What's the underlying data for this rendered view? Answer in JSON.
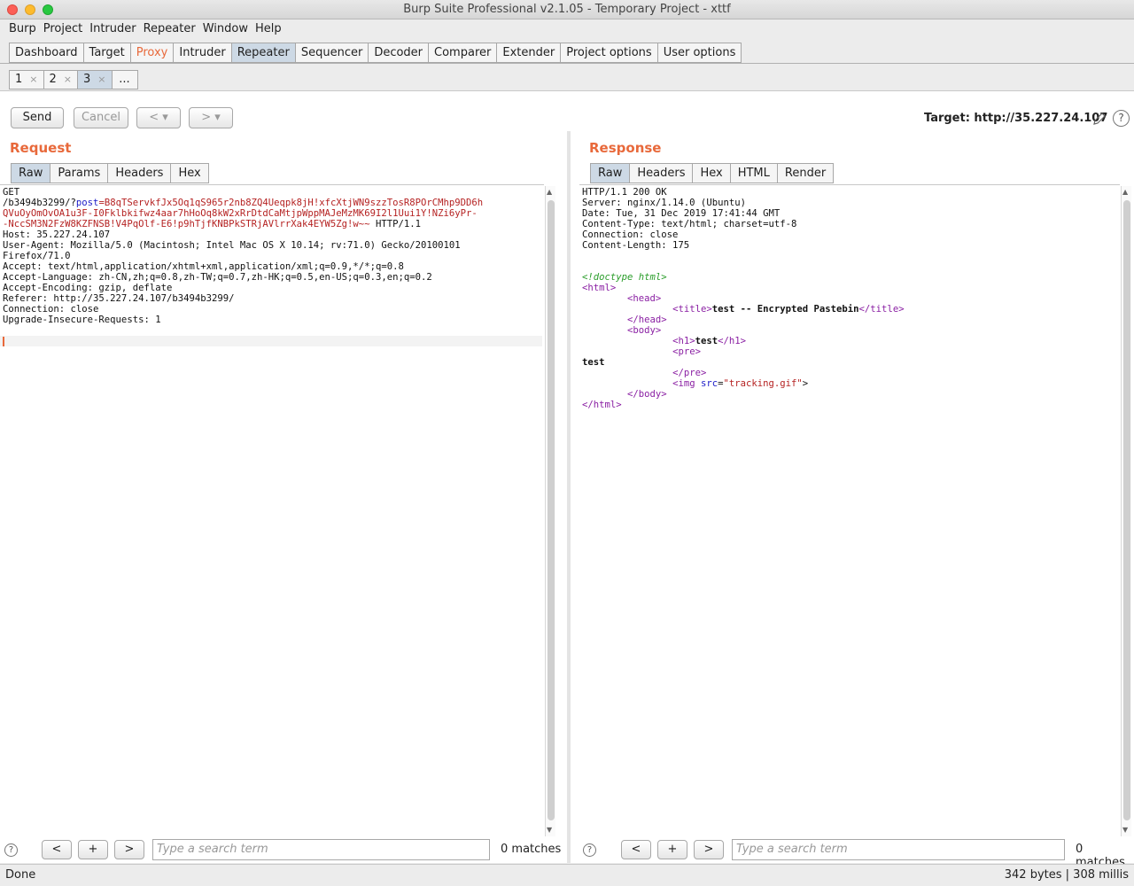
{
  "window": {
    "title": "Burp Suite Professional v2.1.05 - Temporary Project - xttf"
  },
  "menu": [
    "Burp",
    "Project",
    "Intruder",
    "Repeater",
    "Window",
    "Help"
  ],
  "main_tabs": [
    "Dashboard",
    "Target",
    "Proxy",
    "Intruder",
    "Repeater",
    "Sequencer",
    "Decoder",
    "Comparer",
    "Extender",
    "Project options",
    "User options"
  ],
  "sub_tabs": [
    "1",
    "2",
    "3",
    "..."
  ],
  "toolbar": {
    "send": "Send",
    "cancel": "Cancel",
    "back": "< ▾",
    "forward": "> ▾",
    "target_label": "Target: http://35.227.24.107"
  },
  "request": {
    "title": "Request",
    "tabs": [
      "Raw",
      "Params",
      "Headers",
      "Hex"
    ],
    "line1": "GET",
    "line2_prefix": "/b3494b3299/?",
    "param_name": "post",
    "param_eq": "=",
    "param_val_1": "B8qTServkfJx5Oq1qS965r2nb8ZQ4Ueqpk8jH!xfcXtjWN9szzTosR8POrCMhp9DD6h",
    "param_val_2": "QVuOyOmOvOA1u3F-I0Fklbkifwz4aar7hHoOq8kW2xRrDtdCaMtjpWppMAJeMzMK69I2l1Uui1Y!NZi6yPr-",
    "param_val_3": "-NccSM3N2FzW8KZFNSB!V4PqOlf-E6!p9hTjfKNBPkSTRjAVlrrXak4EYW5Zg!w~~",
    "http_ver": " HTTP/1.1",
    "headers": "Host: 35.227.24.107\nUser-Agent: Mozilla/5.0 (Macintosh; Intel Mac OS X 10.14; rv:71.0) Gecko/20100101\nFirefox/71.0\nAccept: text/html,application/xhtml+xml,application/xml;q=0.9,*/*;q=0.8\nAccept-Language: zh-CN,zh;q=0.8,zh-TW;q=0.7,zh-HK;q=0.5,en-US;q=0.3,en;q=0.2\nAccept-Encoding: gzip, deflate\nReferer: http://35.227.24.107/b3494b3299/\nConnection: close\nUpgrade-Insecure-Requests: 1"
  },
  "response": {
    "title": "Response",
    "tabs": [
      "Raw",
      "Headers",
      "Hex",
      "HTML",
      "Render"
    ],
    "headers": "HTTP/1.1 200 OK\nServer: nginx/1.14.0 (Ubuntu)\nDate: Tue, 31 Dec 2019 17:41:44 GMT\nContent-Type: text/html; charset=utf-8\nConnection: close\nContent-Length: 175",
    "doctype": "<!doctype html>",
    "html_open": "<html>",
    "head_open": "<head>",
    "title_open": "<title>",
    "title_text": "test -- Encrypted Pastebin",
    "title_close": "</title>",
    "head_close": "</head>",
    "body_open": "<body>",
    "h1_open": "<h1>",
    "h1_text": "test",
    "h1_close": "</h1>",
    "pre_open": "<pre>",
    "pre_text": "test",
    "pre_close": "</pre>",
    "img_open": "<img ",
    "img_attr": "src",
    "img_eq": "=",
    "img_val": "\"tracking.gif\"",
    "img_close": ">",
    "body_close": "</body>",
    "html_close": "</html>"
  },
  "search": {
    "placeholder": "Type a search term",
    "matches": "0 matches",
    "prev": "<",
    "add": "+",
    "next": ">",
    "help": "?"
  },
  "status": {
    "left": "Done",
    "right": "342 bytes | 308 millis"
  }
}
